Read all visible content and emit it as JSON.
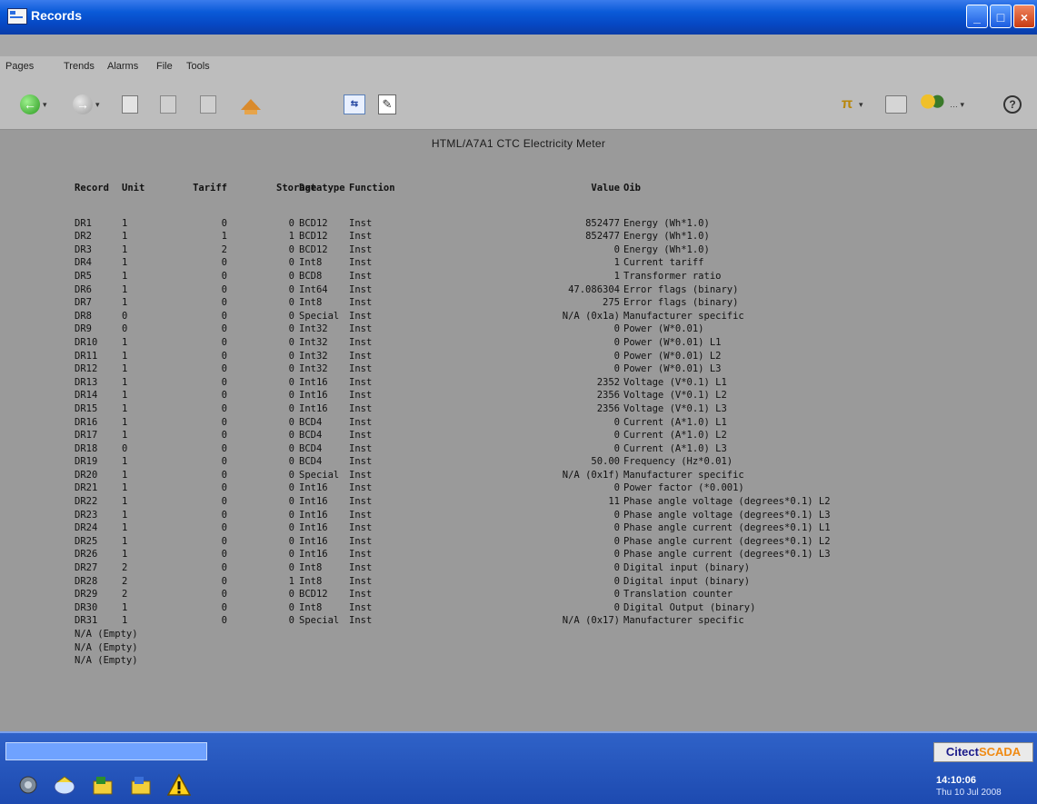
{
  "window": {
    "title": "Records",
    "min_glyph": "_",
    "max_glyph": "□",
    "close_glyph": "×"
  },
  "menu": [
    "Pages",
    "Trends",
    "Alarms",
    "File",
    "Tools"
  ],
  "page_heading": "HTML/A7A1 CTC Electricity Meter",
  "table": {
    "headers": [
      "Record",
      "Unit",
      "Tariff",
      "Storage",
      "Datatype",
      "Function",
      "Value",
      "Oib"
    ],
    "rows": [
      [
        "DR1",
        "1",
        "0",
        "0",
        "BCD12",
        "Inst",
        "852477",
        "Energy (Wh*1.0)"
      ],
      [
        "DR2",
        "1",
        "1",
        "1",
        "BCD12",
        "Inst",
        "852477",
        "Energy (Wh*1.0)"
      ],
      [
        "DR3",
        "1",
        "2",
        "0",
        "BCD12",
        "Inst",
        "0",
        "Energy (Wh*1.0)"
      ],
      [
        "DR4",
        "1",
        "0",
        "0",
        "Int8",
        "Inst",
        "1",
        "Current tariff"
      ],
      [
        "DR5",
        "1",
        "0",
        "0",
        "BCD8",
        "Inst",
        "1",
        "Transformer ratio"
      ],
      [
        "DR6",
        "1",
        "0",
        "0",
        "Int64",
        "Inst",
        "47.086304",
        "Error flags (binary)"
      ],
      [
        "DR7",
        "1",
        "0",
        "0",
        "Int8",
        "Inst",
        "275",
        "Error flags (binary)"
      ],
      [
        "DR8",
        "0",
        "0",
        "0",
        "Special",
        "Inst",
        "N/A (0x1a)",
        "Manufacturer specific"
      ],
      [
        "DR9",
        "0",
        "0",
        "0",
        "Int32",
        "Inst",
        "0",
        "Power (W*0.01)"
      ],
      [
        "DR10",
        "1",
        "0",
        "0",
        "Int32",
        "Inst",
        "0",
        "Power (W*0.01) L1"
      ],
      [
        "DR11",
        "1",
        "0",
        "0",
        "Int32",
        "Inst",
        "0",
        "Power (W*0.01) L2"
      ],
      [
        "DR12",
        "1",
        "0",
        "0",
        "Int32",
        "Inst",
        "0",
        "Power (W*0.01) L3"
      ],
      [
        "DR13",
        "1",
        "0",
        "0",
        "Int16",
        "Inst",
        "2352",
        "Voltage (V*0.1) L1"
      ],
      [
        "DR14",
        "1",
        "0",
        "0",
        "Int16",
        "Inst",
        "2356",
        "Voltage (V*0.1) L2"
      ],
      [
        "DR15",
        "1",
        "0",
        "0",
        "Int16",
        "Inst",
        "2356",
        "Voltage (V*0.1) L3"
      ],
      [
        "DR16",
        "1",
        "0",
        "0",
        "BCD4",
        "Inst",
        "0",
        "Current (A*1.0) L1"
      ],
      [
        "DR17",
        "1",
        "0",
        "0",
        "BCD4",
        "Inst",
        "0",
        "Current (A*1.0) L2"
      ],
      [
        "DR18",
        "0",
        "0",
        "0",
        "BCD4",
        "Inst",
        "0",
        "Current (A*1.0) L3"
      ],
      [
        "DR19",
        "1",
        "0",
        "0",
        "BCD4",
        "Inst",
        "50.00",
        "Frequency (Hz*0.01)"
      ],
      [
        "DR20",
        "1",
        "0",
        "0",
        "Special",
        "Inst",
        "N/A (0x1f)",
        "Manufacturer specific"
      ],
      [
        "DR21",
        "1",
        "0",
        "0",
        "Int16",
        "Inst",
        "0",
        "Power factor (*0.001)"
      ],
      [
        "DR22",
        "1",
        "0",
        "0",
        "Int16",
        "Inst",
        "11",
        "Phase angle voltage (degrees*0.1) L2"
      ],
      [
        "DR23",
        "1",
        "0",
        "0",
        "Int16",
        "Inst",
        "0",
        "Phase angle voltage (degrees*0.1) L3"
      ],
      [
        "DR24",
        "1",
        "0",
        "0",
        "Int16",
        "Inst",
        "0",
        "Phase angle current (degrees*0.1) L1"
      ],
      [
        "DR25",
        "1",
        "0",
        "0",
        "Int16",
        "Inst",
        "0",
        "Phase angle current (degrees*0.1) L2"
      ],
      [
        "DR26",
        "1",
        "0",
        "0",
        "Int16",
        "Inst",
        "0",
        "Phase angle current (degrees*0.1) L3"
      ],
      [
        "DR27",
        "2",
        "0",
        "0",
        "Int8",
        "Inst",
        "0",
        "Digital input (binary)"
      ],
      [
        "DR28",
        "2",
        "0",
        "1",
        "Int8",
        "Inst",
        "0",
        "Digital input (binary)"
      ],
      [
        "DR29",
        "2",
        "0",
        "0",
        "BCD12",
        "Inst",
        "0",
        "Translation counter"
      ],
      [
        "DR30",
        "1",
        "0",
        "0",
        "Int8",
        "Inst",
        "0",
        "Digital Output (binary)"
      ],
      [
        "DR31",
        "1",
        "0",
        "0",
        "Special",
        "Inst",
        "N/A (0x17)",
        "Manufacturer specific"
      ],
      [
        "N/A (Empty)",
        "",
        "",
        "",
        "",
        "",
        "",
        ""
      ],
      [
        "N/A (Empty)",
        "",
        "",
        "",
        "",
        "",
        "",
        ""
      ],
      [
        "N/A (Empty)",
        "",
        "",
        "",
        "",
        "",
        "",
        ""
      ]
    ]
  },
  "status": {
    "brand_a": "Citect",
    "brand_b": "SCADA",
    "time": "14:10:06",
    "date": "Thu 10 Jul 2008"
  },
  "icons": [
    "back-icon",
    "forward-icon",
    "page-icon",
    "page-icon",
    "page-icon",
    "home-icon",
    "compare-icon",
    "edit-icon",
    "trend-icon",
    "print-icon",
    "users-icon",
    "help-icon"
  ]
}
